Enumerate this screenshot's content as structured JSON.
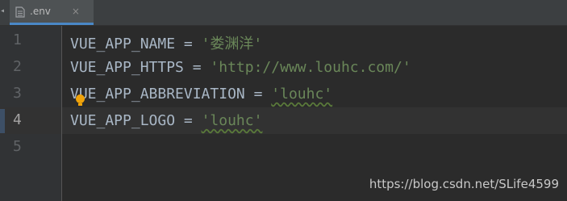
{
  "tab": {
    "filename": ".env",
    "close_glyph": "×"
  },
  "gutter": {
    "line_numbers": [
      "1",
      "2",
      "3",
      "4",
      "5"
    ],
    "current_line": "4"
  },
  "code": {
    "lines": [
      {
        "key": "VUE_APP_NAME",
        "eq": " = ",
        "value": "'娄渊洋'"
      },
      {
        "key": "VUE_APP_HTTPS",
        "eq": " = ",
        "value": "'http://www.louhc.com/'"
      },
      {
        "key": "VUE_APP_ABBREVIATION",
        "eq": " = ",
        "value": "'louhc'"
      },
      {
        "key": "VUE_APP_LOGO",
        "eq": " = ",
        "value": "'louhc'"
      }
    ]
  },
  "watermark": {
    "text": "https://blog.csdn.net/SLife4599"
  },
  "colors": {
    "background": "#2b2b2b",
    "gutter": "#313335",
    "key": "#a9b7c6",
    "string": "#6a8759",
    "line_number": "#606366",
    "bulb": "#f0a30a"
  },
  "icons": {
    "file": "document-icon",
    "intention": "lightbulb-icon"
  }
}
